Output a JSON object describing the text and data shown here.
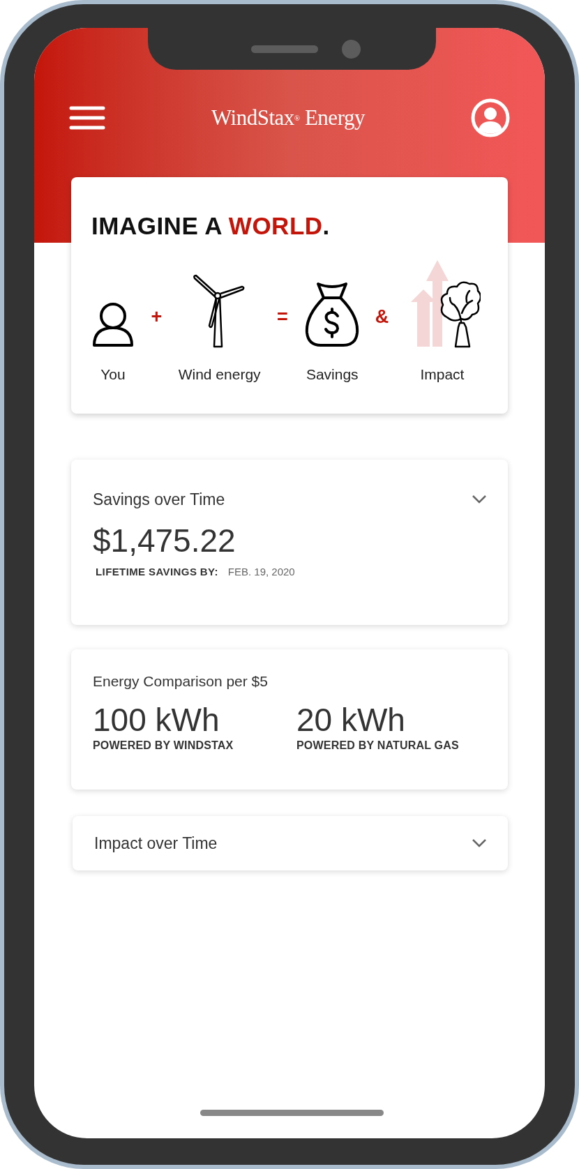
{
  "header": {
    "title": "WindStax$^{®}$ Energy"
  },
  "intro": {
    "heading": {
      "before": "IMAGINE A ",
      "accent": "WORLD",
      "after": "."
    },
    "equation": [
      {
        "kind": "person",
        "label": "You"
      },
      {
        "kind": "operator",
        "symbol": "+"
      },
      {
        "kind": "turbine",
        "label": "Wind energy"
      },
      {
        "kind": "operator",
        "symbol": "="
      },
      {
        "kind": "moneybag",
        "label": "Savings"
      },
      {
        "kind": "operator",
        "symbol": "&"
      },
      {
        "kind": "tree",
        "label": "Impact"
      }
    ]
  },
  "savings": {
    "title": "Savings over Time",
    "amount": "$1,475.22",
    "caption_label": "LIFETIME SAVINGS BY:",
    "caption_date": "FEB. 19, 2020"
  },
  "comparison": {
    "title": "Energy Comparison per $5",
    "stats": [
      {
        "value": "100 kWh",
        "label": "POWERED BY WINDSTAX"
      },
      {
        "value": "20 kWh",
        "label": "POWERED BY NATURAL GAS"
      }
    ]
  },
  "impact": {
    "title": "Impact over Time"
  }
}
